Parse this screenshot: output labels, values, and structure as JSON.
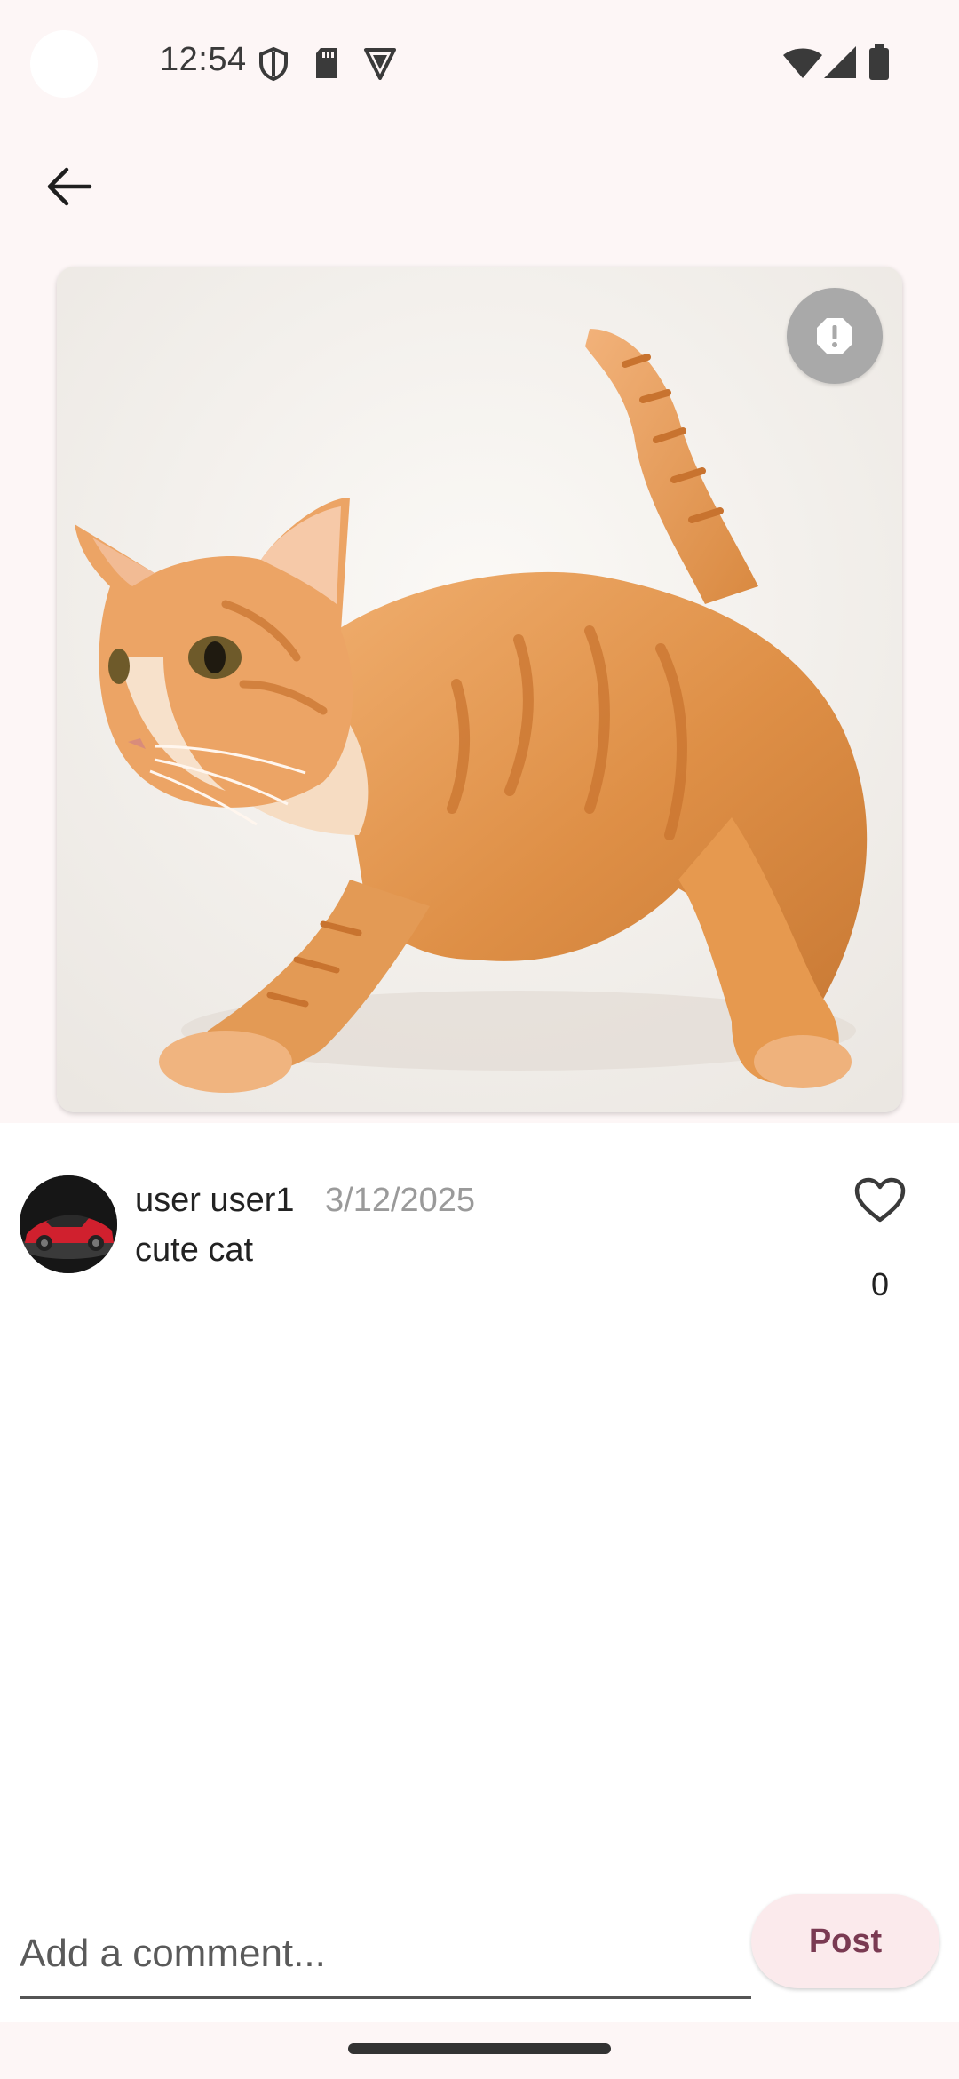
{
  "status_bar": {
    "time": "12:54"
  },
  "app_bar": {
    "back_icon": "arrow-back-icon"
  },
  "post": {
    "image_description_icon": "cat-photo",
    "report_icon": "report-icon",
    "author": "user user1",
    "date": "3/12/2025",
    "caption": "cute cat",
    "like_count": "0",
    "like_icon": "heart-outline-icon"
  },
  "comment": {
    "placeholder": "Add a comment...",
    "post_label": "Post"
  },
  "colors": {
    "background_top": "#fdf6f6",
    "accent": "#7a3a52",
    "post_button_bg": "#fbeaec"
  }
}
